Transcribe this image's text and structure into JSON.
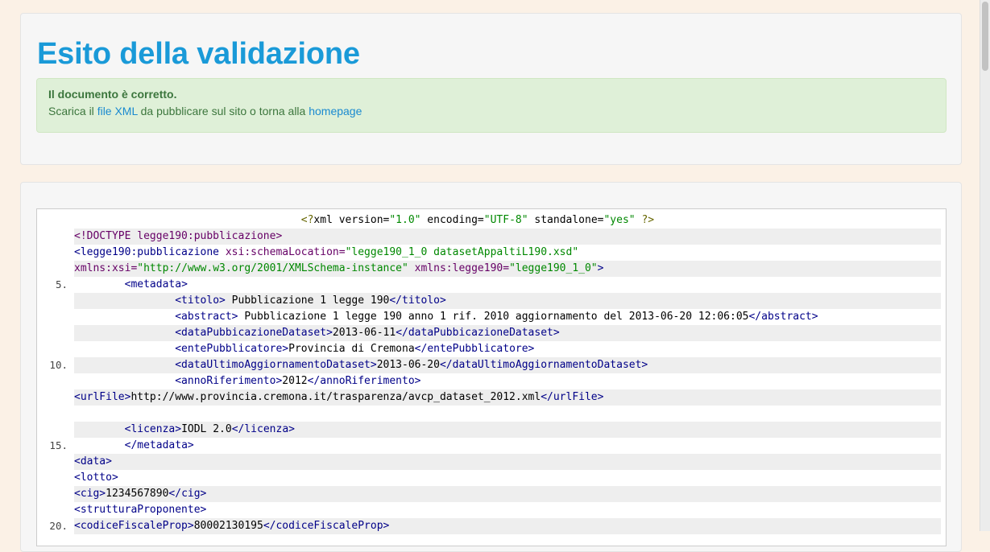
{
  "result": {
    "title": "Esito della validazione",
    "alert_strong": "Il documento è corretto.",
    "alert_prefix": "Scarica il ",
    "alert_link_file": "file XML",
    "alert_middle": " da pubblicare sul sito o torna alla ",
    "alert_link_home": "homepage"
  },
  "code": {
    "lines": [
      {
        "n": "",
        "indent": 36,
        "parts": [
          [
            "pi",
            "<?"
          ],
          [
            "txt",
            "xml version="
          ],
          [
            "val",
            "\"1.0\""
          ],
          [
            "txt",
            " encoding="
          ],
          [
            "val",
            "\"UTF-8\""
          ],
          [
            "txt",
            " standalone="
          ],
          [
            "val",
            "\"yes\""
          ],
          [
            "pi",
            " ?>"
          ]
        ]
      },
      {
        "n": "",
        "indent": 0,
        "parts": [
          [
            "decl",
            "<!DOCTYPE legge190:pubblicazione>"
          ]
        ]
      },
      {
        "n": "",
        "indent": 0,
        "parts": [
          [
            "tag",
            "<legge190:pubblicazione"
          ],
          [
            "attr",
            " xsi:schemaLocation="
          ],
          [
            "val",
            "\"legge190_1_0 datasetAppaltiL190.xsd\""
          ]
        ]
      },
      {
        "n": "",
        "indent": 0,
        "parts": [
          [
            "attr",
            "xmlns:xsi="
          ],
          [
            "val",
            "\"http://www.w3.org/2001/XMLSchema-instance\""
          ],
          [
            "attr",
            " xmlns:legge190="
          ],
          [
            "val",
            "\"legge190_1_0\""
          ],
          [
            "tag",
            ">"
          ]
        ]
      },
      {
        "n": "5.",
        "indent": 8,
        "parts": [
          [
            "tag",
            "<metadata>"
          ]
        ]
      },
      {
        "n": "",
        "indent": 16,
        "parts": [
          [
            "tag",
            "<titolo>"
          ],
          [
            "txt",
            " Pubblicazione 1 legge 190"
          ],
          [
            "tag",
            "</titolo>"
          ]
        ]
      },
      {
        "n": "",
        "indent": 16,
        "parts": [
          [
            "tag",
            "<abstract>"
          ],
          [
            "txt",
            " Pubblicazione 1 legge 190 anno 1 rif. 2010 aggiornamento del 2013-06-20 12:06:05"
          ],
          [
            "tag",
            "</abstract>"
          ]
        ]
      },
      {
        "n": "",
        "indent": 16,
        "parts": [
          [
            "tag",
            "<dataPubbicazioneDataset>"
          ],
          [
            "txt",
            "2013-06-11"
          ],
          [
            "tag",
            "</dataPubbicazioneDataset>"
          ]
        ]
      },
      {
        "n": "",
        "indent": 16,
        "parts": [
          [
            "tag",
            "<entePubblicatore>"
          ],
          [
            "txt",
            "Provincia di Cremona"
          ],
          [
            "tag",
            "</entePubblicatore>"
          ]
        ]
      },
      {
        "n": "10.",
        "indent": 16,
        "parts": [
          [
            "tag",
            "<dataUltimoAggiornamentoDataset>"
          ],
          [
            "txt",
            "2013-06-20"
          ],
          [
            "tag",
            "</dataUltimoAggiornamentoDataset>"
          ]
        ]
      },
      {
        "n": "",
        "indent": 16,
        "parts": [
          [
            "tag",
            "<annoRiferimento>"
          ],
          [
            "txt",
            "2012"
          ],
          [
            "tag",
            "</annoRiferimento>"
          ]
        ]
      },
      {
        "n": "",
        "indent": 0,
        "parts": [
          [
            "tag",
            "<urlFile>"
          ],
          [
            "txt",
            "http://www.provincia.cremona.it/trasparenza/avcp_dataset_2012.xml"
          ],
          [
            "tag",
            "</urlFile>"
          ]
        ]
      },
      {
        "n": "",
        "indent": 0,
        "parts": []
      },
      {
        "n": "",
        "indent": 8,
        "parts": [
          [
            "tag",
            "<licenza>"
          ],
          [
            "txt",
            "IODL 2.0"
          ],
          [
            "tag",
            "</licenza>"
          ]
        ]
      },
      {
        "n": "15.",
        "indent": 8,
        "parts": [
          [
            "tag",
            "</metadata>"
          ]
        ]
      },
      {
        "n": "",
        "indent": 0,
        "parts": [
          [
            "tag",
            "<data>"
          ]
        ]
      },
      {
        "n": "",
        "indent": 0,
        "parts": [
          [
            "tag",
            "<lotto>"
          ]
        ]
      },
      {
        "n": "",
        "indent": 0,
        "parts": [
          [
            "tag",
            "<cig>"
          ],
          [
            "txt",
            "1234567890"
          ],
          [
            "tag",
            "</cig>"
          ]
        ]
      },
      {
        "n": "",
        "indent": 0,
        "parts": [
          [
            "tag",
            "<strutturaProponente>"
          ]
        ]
      },
      {
        "n": "20.",
        "indent": 0,
        "parts": [
          [
            "tag",
            "<codiceFiscaleProp>"
          ],
          [
            "txt",
            "80002130195"
          ],
          [
            "tag",
            "</codiceFiscaleProp>"
          ]
        ]
      }
    ]
  }
}
